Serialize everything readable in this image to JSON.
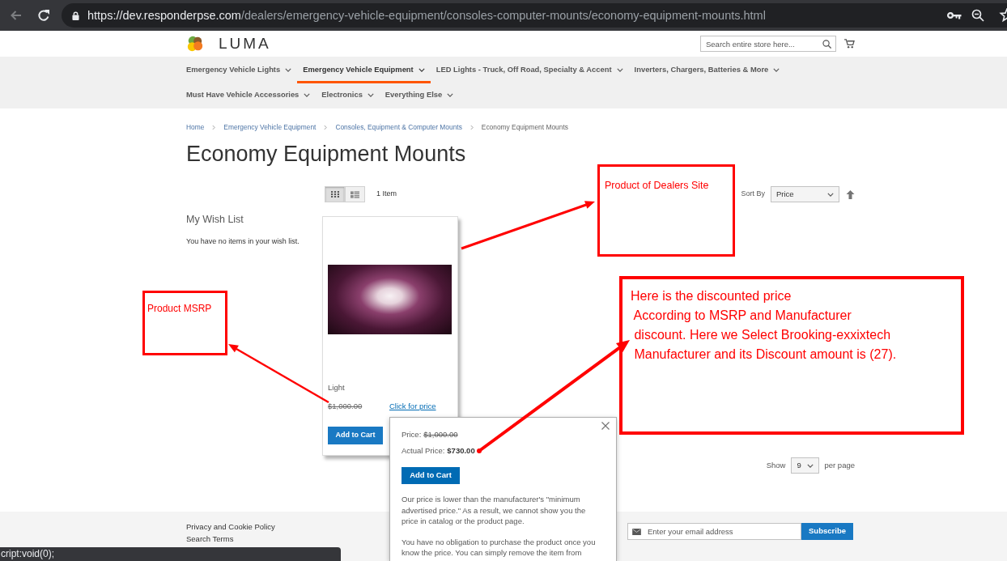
{
  "browser": {
    "back": {
      "disabled": true
    },
    "url_host": "https://dev.responderpse.com",
    "url_path": "/dealers/emergency-vehicle-equipment/consoles-computer-mounts/economy-equipment-mounts.html"
  },
  "header": {
    "logo": "LUMA",
    "search": {
      "placeholder": "Search entire store here..."
    }
  },
  "nav": {
    "rows": [
      {
        "items": [
          {
            "label": "Emergency Vehicle Lights",
            "selected": false
          },
          {
            "label": "Emergency Vehicle Equipment",
            "selected": true
          },
          {
            "label": "LED Lights - Truck, Off Road, Specialty & Accent",
            "selected": false
          },
          {
            "label": "Inverters, Chargers, Batteries & More",
            "selected": false
          }
        ]
      },
      {
        "items": [
          {
            "label": "Must Have Vehicle Accessories",
            "selected": false
          },
          {
            "label": "Electronics",
            "selected": false
          },
          {
            "label": "Everything Else",
            "selected": false
          }
        ]
      }
    ]
  },
  "breadcrumbs": [
    {
      "label": "Home",
      "current": false
    },
    {
      "label": "Emergency Vehicle Equipment",
      "current": false
    },
    {
      "label": "Consoles, Equipment & Computer Mounts",
      "current": false
    },
    {
      "label": "Economy Equipment Mounts",
      "current": true
    }
  ],
  "title": "Economy Equipment Mounts",
  "toolbar": {
    "view_modes": [
      {
        "kind": "grid",
        "selected": true
      },
      {
        "kind": "list",
        "selected": false
      }
    ],
    "count": "1 Item",
    "sort_label": "Sort By",
    "sort_value": "Price"
  },
  "sidebar": {
    "title": "My Wish List",
    "text": "You have no items in your wish list."
  },
  "products": [
    {
      "name": "Light",
      "msrp": "$1,000.00",
      "price_link": "Click for price",
      "button": "Add to Cart"
    }
  ],
  "pager": {
    "label": "Show",
    "value": "9",
    "suffix": "per page"
  },
  "footer": {
    "links": [
      "Privacy and Cookie Policy",
      "Search Terms"
    ],
    "newsletter": {
      "placeholder": "Enter your email address",
      "button": "Subscribe"
    }
  },
  "price_popup": {
    "price_label": "Price:",
    "price": "$1,000.00",
    "actual_label": "Actual Price:",
    "actual_price": "$730.00",
    "button": "Add to Cart",
    "paragraphs": [
      "Our price is lower than the manufacturer's \"minimum advertised price.\" As a result, we cannot show you the price in catalog or the product page.",
      "You have no obligation to purchase the product once you know the price. You can simply remove the item from"
    ]
  },
  "annotations": [
    {
      "text": "Product of Dealers Site"
    },
    {
      "text": "Product MSRP"
    },
    {
      "text": "Here is the discounted price\n According to MSRP and Manufacturer\n discount. Here we Select Brooking-exxixtech\n Manufacturer and its Discount amount is (27)."
    }
  ],
  "status_bar": "cript:void(0);"
}
